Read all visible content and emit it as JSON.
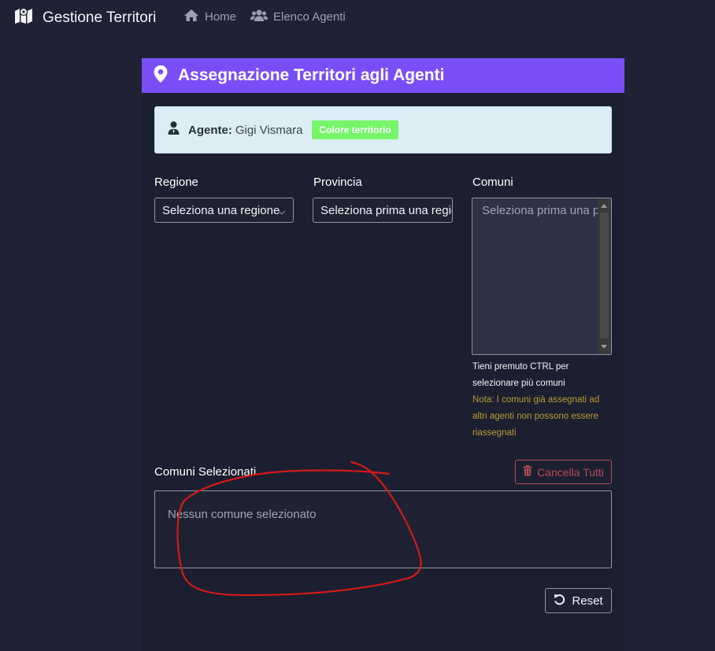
{
  "navbar": {
    "brand_title": "Gestione Territori",
    "brand_icon": "map-icon",
    "links": [
      {
        "label": "Home",
        "icon": "home-icon"
      },
      {
        "label": "Elenco Agenti",
        "icon": "users-icon"
      }
    ]
  },
  "card": {
    "title": "Assegnazione Territori agli Agenti",
    "header_icon": "map-marker-icon",
    "header_color": "#7a4ef7"
  },
  "agent": {
    "label": "Agente:",
    "name": "Gigi Vismara",
    "badge": "Colore territorio",
    "badge_color": "#76f56a"
  },
  "form": {
    "region": {
      "label": "Regione",
      "value": "Seleziona una regione"
    },
    "province": {
      "label": "Provincia",
      "value": "Seleziona prima una regione"
    },
    "comuni": {
      "label": "Comuni",
      "placeholder": "Seleziona prima una provincia"
    },
    "help": "Tieni premuto CTRL per selezionare più comuni",
    "note": "Nota: I comuni già assegnati ad altri agenti non possono essere riassegnati"
  },
  "selected": {
    "label": "Comuni Selezionati",
    "clear_label": "Cancella Tutti",
    "empty_text": "Nessun comune selezionato"
  },
  "actions": {
    "reset_label": "Reset"
  },
  "colors": {
    "background": "#1f2234",
    "danger": "#b24c55",
    "annotation": "#d21a1a"
  }
}
